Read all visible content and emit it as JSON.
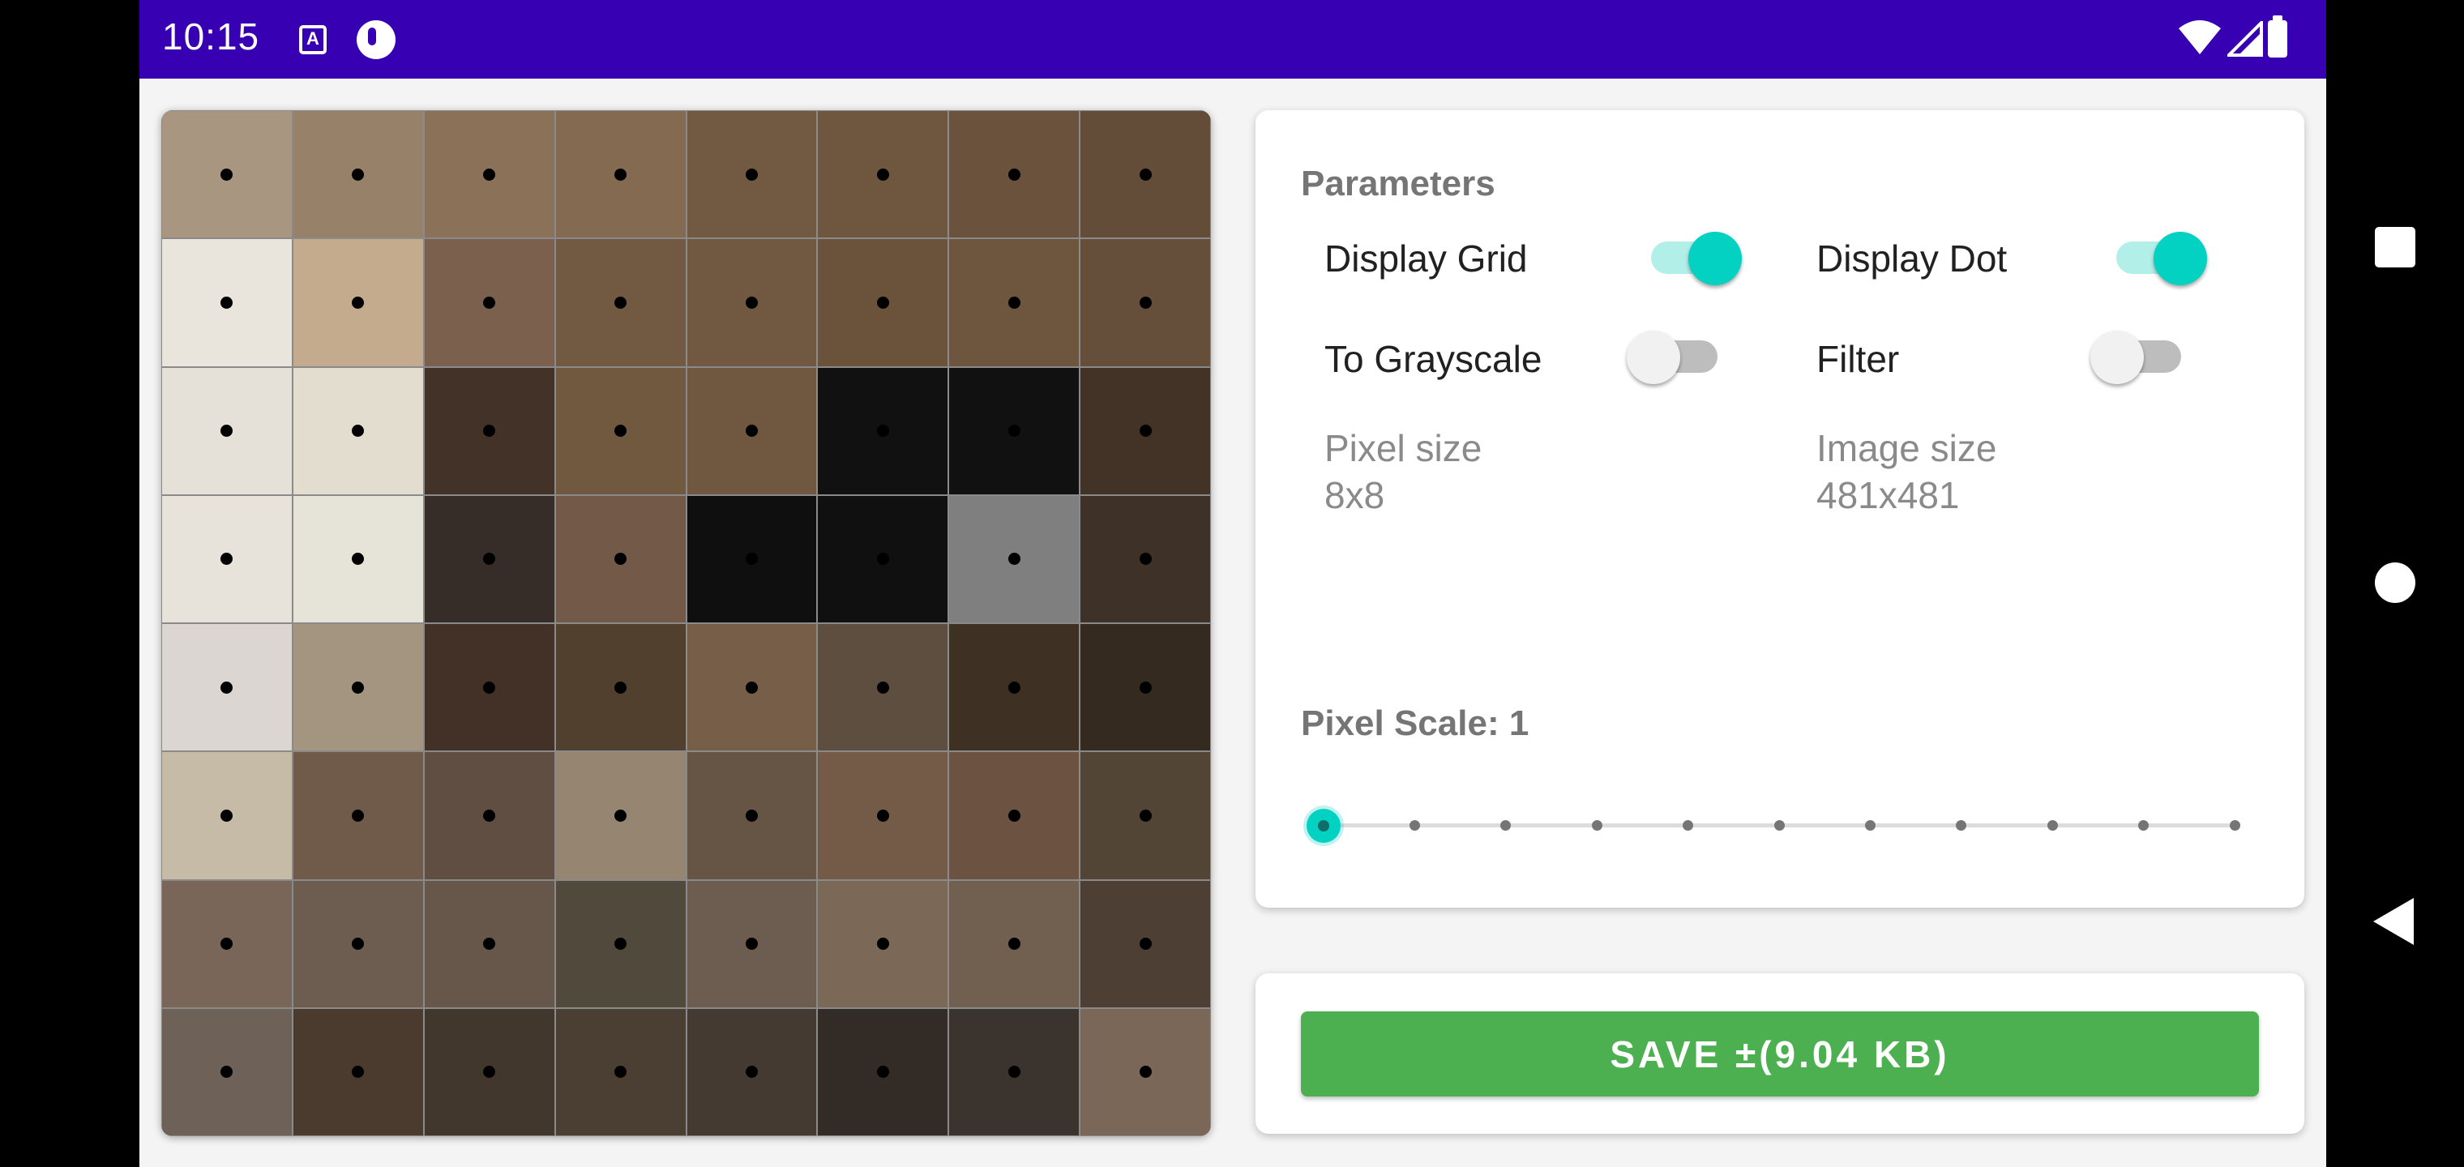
{
  "status_bar": {
    "time": "10:15",
    "a_icon": "A",
    "color": "#3700b3"
  },
  "pixel_grid": {
    "rows": 8,
    "cols": 8,
    "colors": [
      [
        "#a89680",
        "#978168",
        "#8b7158",
        "#836a50",
        "#715942",
        "#6e563f",
        "#6a523c",
        "#634d38"
      ],
      [
        "#e9e5dc",
        "#c4ab8e",
        "#7a604d",
        "#715942",
        "#715941",
        "#6b523b",
        "#6d553e",
        "#654f3a"
      ],
      [
        "#e6e1d8",
        "#e3ddd0",
        "#433227",
        "#715940",
        "#6f5740",
        "#111111",
        "#111111",
        "#433327"
      ],
      [
        "#e8e3da",
        "#e6e3d9",
        "#362d28",
        "#735a48",
        "#0f0f0f",
        "#101010",
        "#7f7f7f",
        "#3e3228"
      ],
      [
        "#dcd6d2",
        "#a49581",
        "#433128",
        "#52402f",
        "#765e48",
        "#5e4e40",
        "#3f3024",
        "#352a20"
      ],
      [
        "#c6bba6",
        "#705a49",
        "#614e42",
        "#968571",
        "#665445",
        "#735b48",
        "#6c5341",
        "#524536"
      ],
      [
        "#7a6658",
        "#6d5d51",
        "#67574b",
        "#51493c",
        "#6c5d50",
        "#7b6857",
        "#71604f",
        "#4d3f33"
      ],
      [
        "#6e6157",
        "#4b3b2f",
        "#42372d",
        "#4b3f33",
        "#443a31",
        "#332b25",
        "#3b332d",
        "#7b6757"
      ]
    ]
  },
  "parameters": {
    "title": "Parameters",
    "display_grid": {
      "label": "Display Grid",
      "enabled": true
    },
    "display_dot": {
      "label": "Display Dot",
      "enabled": true
    },
    "to_grayscale": {
      "label": "To Grayscale",
      "enabled": false
    },
    "filter": {
      "label": "Filter",
      "enabled": false
    },
    "pixel_size": {
      "label": "Pixel size",
      "value": "8x8"
    },
    "image_size": {
      "label": "Image size",
      "value": "481x481"
    },
    "pixel_scale": {
      "label": "Pixel Scale: 1",
      "value": 1,
      "min": 1,
      "max": 11,
      "steps": 11
    }
  },
  "save": {
    "label": "SAVE ±(9.04 KB)"
  },
  "colors": {
    "accent": "#03d1c1",
    "save_green": "#4caf50"
  },
  "nav_bar": {
    "icons": [
      "recents-square-icon",
      "home-circle-icon",
      "back-triangle-icon"
    ]
  }
}
